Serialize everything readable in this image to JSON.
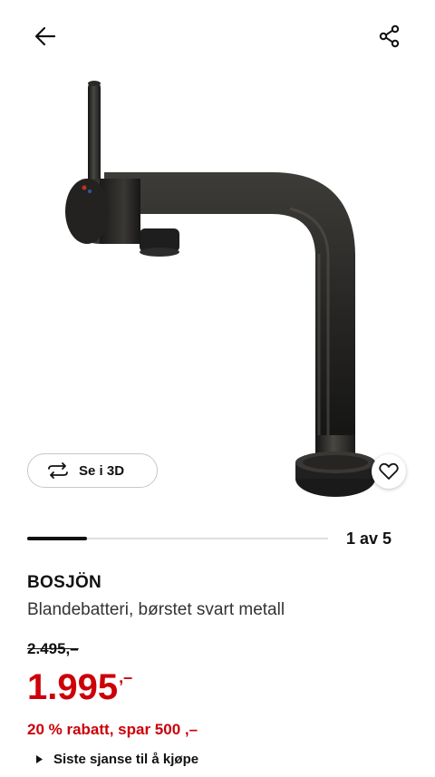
{
  "header": {
    "back_icon": "arrow-left-icon",
    "share_icon": "share-icon"
  },
  "gallery": {
    "view_3d_label": "Se i 3D",
    "view_3d_icon": "rotate-icon",
    "favorite_icon": "heart-icon",
    "counter": "1 av 5",
    "progress_fraction": 0.2
  },
  "product": {
    "name": "BOSJÖN",
    "description": "Blandebatteri, børstet svart metall",
    "old_price": "2.495,–",
    "new_price": "1.995",
    "new_price_suffix": ",–",
    "discount": "20 % rabatt, spar 500 ,–",
    "last_chance": "Siste sjanse til å kjøpe"
  },
  "colors": {
    "price_red": "#cc0008",
    "text_dark": "#111111"
  }
}
